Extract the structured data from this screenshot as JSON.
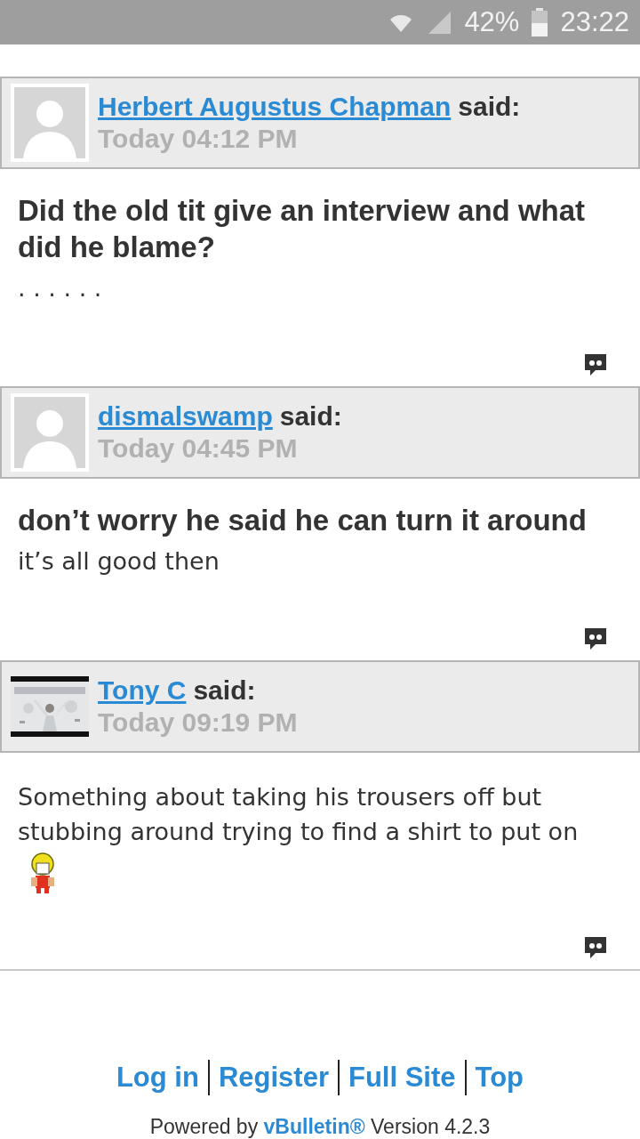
{
  "status_bar": {
    "battery_text": "42%",
    "time": "23:22"
  },
  "posts": [
    {
      "avatar": {
        "kind": "default"
      },
      "author": "Herbert Augustus Chapman",
      "said": "said:",
      "date": "Today 04:12 PM",
      "title": "Did the old tit give an interview and what did he blame?",
      "text": ". . . . . .",
      "smiley": false
    },
    {
      "avatar": {
        "kind": "default"
      },
      "author": "dismalswamp",
      "said": "said:",
      "date": "Today 04:45 PM",
      "title": "don’t worry he said he can turn it around",
      "text": "it’s all good then",
      "smiley": false
    },
    {
      "author": "Tony C",
      "said": "said:",
      "date": "Today 09:19 PM",
      "text": "Something about taking his trousers off but stubbing around trying to find a shirt to put on",
      "smiley": true
    }
  ],
  "footer": {
    "links": [
      "Log in",
      "Register",
      "Full Site",
      "Top"
    ],
    "powered_prefix": "Powered by ",
    "powered_link": "vBulletin®",
    "powered_suffix": " Version 4.2.3"
  }
}
